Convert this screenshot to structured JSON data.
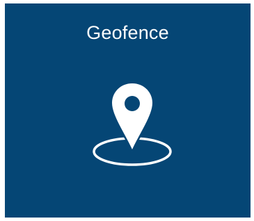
{
  "tile": {
    "label": "Geofence",
    "icon": "geofence-location-pin-icon",
    "background_color": "#054675",
    "text_color": "#ffffff"
  }
}
